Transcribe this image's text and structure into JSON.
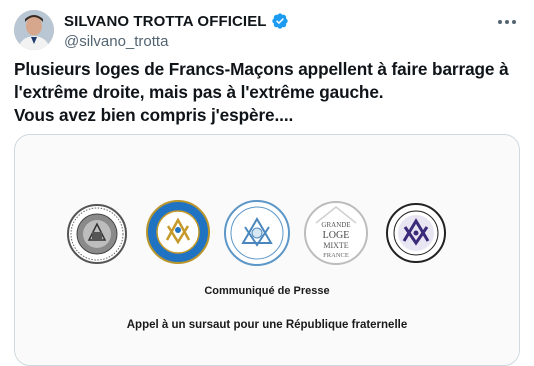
{
  "author": {
    "display_name": "SILVANO TROTTA OFFICIEL",
    "handle": "@silvano_trotta"
  },
  "tweet": {
    "text": "Plusieurs loges de Francs-Maçons appellent à faire barrage à\nl'extrême droite, mais pas à l'extrême gauche.\nVous avez bien compris j'espère...."
  },
  "media": {
    "logo4_text": [
      "GRANDE",
      "LOGE",
      "MIXTE",
      "FRANCE"
    ],
    "communique": "Communiqué de Presse",
    "appel": "Appel à un sursaut pour une République fraternelle"
  },
  "icons": {
    "verified": "verified-badge-icon",
    "more": "more-options-icon"
  },
  "colors": {
    "verified_blue": "#1d9bf0",
    "logo2_blue": "#1f73c2",
    "logo5_purple": "#3b2a7a"
  }
}
